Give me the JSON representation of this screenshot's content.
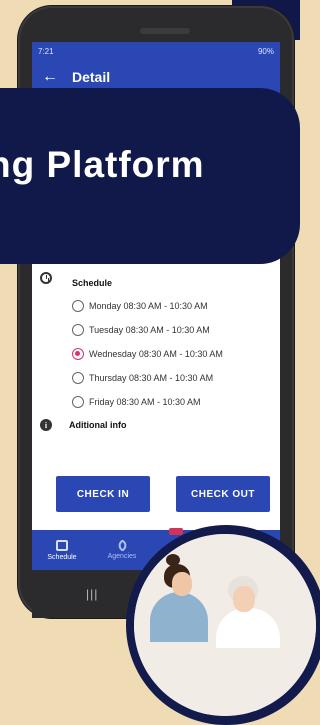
{
  "banner": {
    "text": "ng Platform"
  },
  "phone": {
    "status_time": "7:21",
    "status_right": "90%",
    "appbar": {
      "back_icon": "arrow-left-icon",
      "title": "Detail"
    }
  },
  "schedule": {
    "label": "Schedule",
    "options": [
      {
        "text": "Monday 08:30 AM - 10:30 AM",
        "selected": false
      },
      {
        "text": "Tuesday 08:30 AM - 10:30 AM",
        "selected": false
      },
      {
        "text": "Wednesday 08:30 AM - 10:30 AM",
        "selected": true
      },
      {
        "text": "Thursday 08:30 AM - 10:30 AM",
        "selected": false
      },
      {
        "text": "Friday 08:30 AM - 10:30 AM",
        "selected": false
      }
    ]
  },
  "info": {
    "label": "Aditional info"
  },
  "buttons": {
    "check_in": "CHECK IN",
    "check_out": "CHECK OUT"
  },
  "bottom_nav": {
    "items": [
      {
        "label": "Schedule",
        "icon": "calendar-icon"
      },
      {
        "label": "Agencies",
        "icon": "tag-icon"
      }
    ]
  },
  "colors": {
    "app_blue": "#2a47b4",
    "banner_navy": "#11194b",
    "selected_pink": "#e0316d",
    "background": "#efdcb4"
  }
}
